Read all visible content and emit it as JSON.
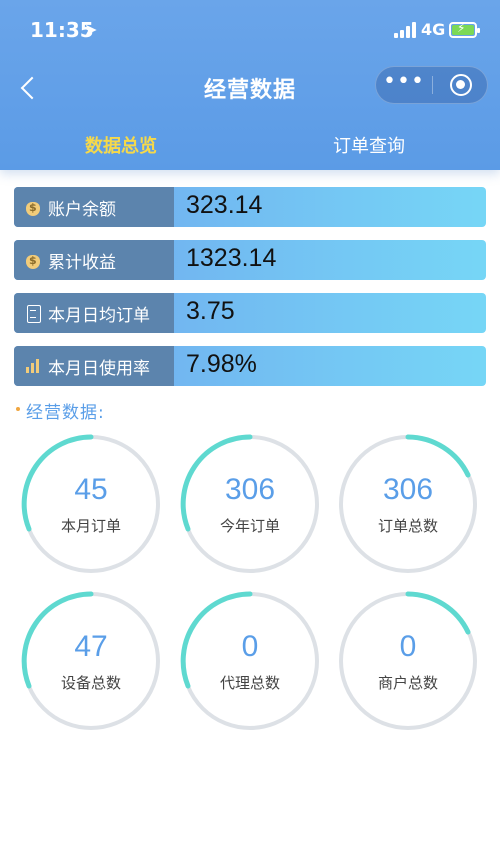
{
  "status_bar": {
    "time": "11:35",
    "network": "4G"
  },
  "nav": {
    "title": "经营数据"
  },
  "tabs": [
    {
      "label": "数据总览",
      "active": true
    },
    {
      "label": "订单查询",
      "active": false
    }
  ],
  "metrics": [
    {
      "label": "账户余额",
      "value": "323.14",
      "icon": "money-bag-icon"
    },
    {
      "label": "累计收益",
      "value": "1323.14",
      "icon": "money-bag-icon"
    },
    {
      "label": "本月日均订单",
      "value": "3.75",
      "icon": "document-icon"
    },
    {
      "label": "本月日使用率",
      "value": "7.98%",
      "icon": "bar-chart-icon"
    }
  ],
  "section": {
    "title": "经营数据:"
  },
  "stats": [
    {
      "value": "45",
      "label": "本月订单"
    },
    {
      "value": "306",
      "label": "今年订单"
    },
    {
      "value": "306",
      "label": "订单总数"
    },
    {
      "value": "47",
      "label": "设备总数"
    },
    {
      "value": "0",
      "label": "代理总数"
    },
    {
      "value": "0",
      "label": "商户总数"
    }
  ],
  "colors": {
    "header": "#5b9be6",
    "active_tab": "#f6d94a",
    "label_box": "#5c84ad",
    "gauge_track": "#dde1e6",
    "gauge_arc": "#5fd9d0",
    "accent_text": "#5a9ee8"
  }
}
